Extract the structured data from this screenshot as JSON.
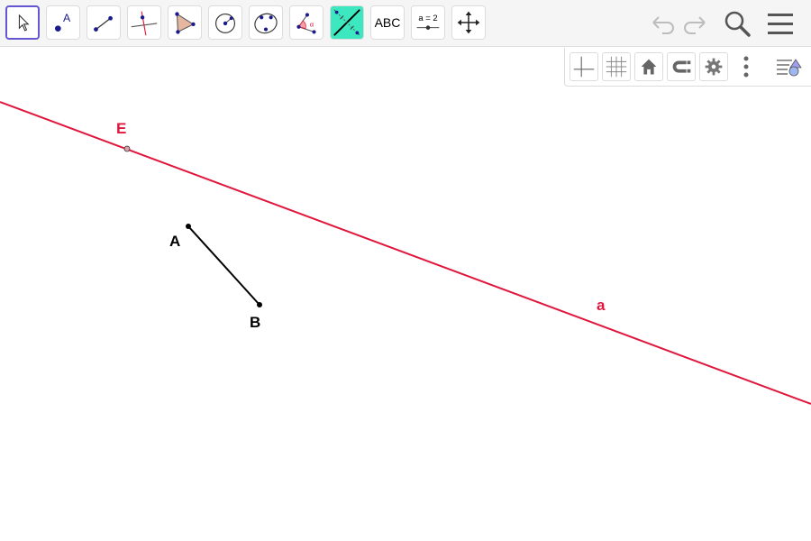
{
  "toolbar": {
    "tools": [
      {
        "name": "move",
        "icon": "arrow-pointer-icon"
      },
      {
        "name": "point",
        "icon": "point-icon",
        "label": "A"
      },
      {
        "name": "segment",
        "icon": "segment-icon"
      },
      {
        "name": "perpendicular-line",
        "icon": "perpendicular-line-icon"
      },
      {
        "name": "polygon",
        "icon": "polygon-icon"
      },
      {
        "name": "circle-center-point",
        "icon": "circle-icon"
      },
      {
        "name": "conic-through-points",
        "icon": "ellipse-icon"
      },
      {
        "name": "angle",
        "icon": "angle-icon",
        "label": "α"
      },
      {
        "name": "reflect",
        "icon": "reflect-icon"
      },
      {
        "name": "text",
        "icon": "text-icon",
        "label": "ABC"
      },
      {
        "name": "slider",
        "icon": "slider-icon",
        "label": "a = 2"
      },
      {
        "name": "move-graphics-view",
        "icon": "move-graphics-icon"
      }
    ],
    "right_buttons": [
      "undo-icon",
      "redo-icon",
      "search-icon",
      "menu-icon"
    ]
  },
  "style_bar": {
    "buttons": [
      "axes-icon",
      "grid-icon",
      "home-icon",
      "point-capturing-icon",
      "settings-icon",
      "more-vertical-icon",
      "style-bar-toggle-icon"
    ]
  },
  "canvas": {
    "labels": {
      "point_E": "E",
      "point_A": "A",
      "point_B": "B",
      "line_a": "a"
    }
  },
  "colors": {
    "line": "#e0163c",
    "segment": "#000000",
    "selected_border": "#6557d2",
    "icon_blue": "#1a1a8c",
    "reflect_bg": "#3de8c0"
  }
}
